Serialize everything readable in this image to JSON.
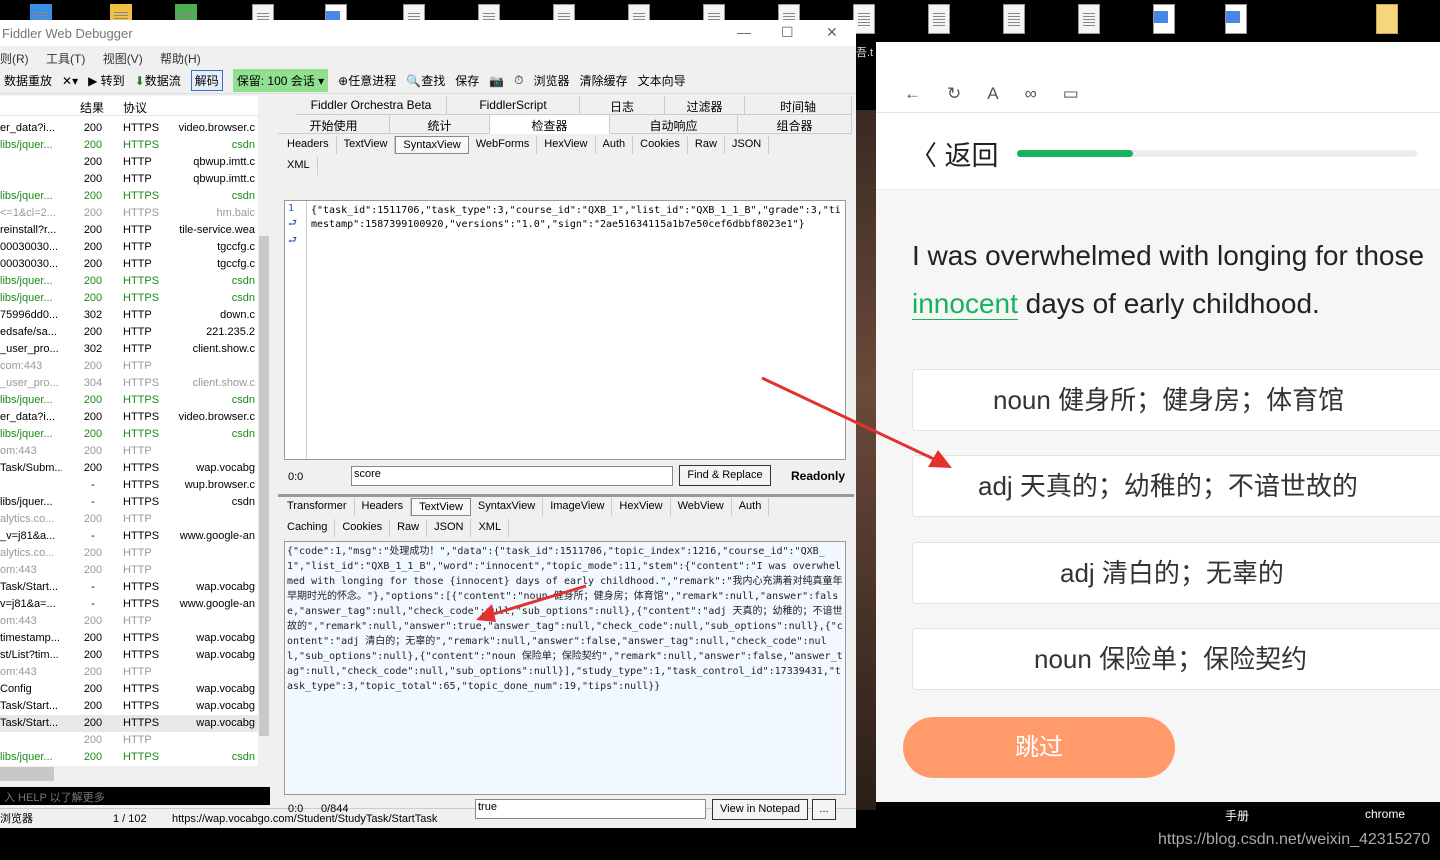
{
  "desktop": {
    "icons": [
      "app-icon",
      "app-icon",
      "app-icon",
      "text-file-icon",
      "word-file-icon",
      "text-file-icon",
      "text-file-icon",
      "text-file-icon",
      "text-file-icon",
      "text-file-icon",
      "text-file-icon",
      "text-file-icon",
      "text-file-icon",
      "text-file-icon",
      "text-file-icon",
      "word-file-icon",
      "word-file-icon",
      "folder-icon"
    ],
    "label_partial": "吾.t",
    "bottom_labels": [
      "手册",
      "chrome"
    ],
    "watermark": "https://blog.csdn.net/weixin_42315270"
  },
  "fiddler": {
    "title": "Fiddler Web Debugger",
    "menu": [
      "规则(R)",
      "工具(T)",
      "视图(V)",
      "帮助(H)"
    ],
    "toolbar": {
      "replay": "数据重放",
      "remove": "✕▾",
      "go": "▶ 转到",
      "stream": "数据流",
      "decode": "解码",
      "keep": "保留: 100 会话 ▾",
      "any_process": "任意进程",
      "find": "查找",
      "save": "保存",
      "browse": "浏览器",
      "clear_cache": "清除缓存",
      "text_wizard": "文本向导"
    },
    "columns": {
      "result": "结果",
      "protocol": "协议"
    },
    "sessions": [
      {
        "url": "er_data?i...",
        "result": "200",
        "protocol": "HTTPS",
        "host": "video.browser.c",
        "style": "normal"
      },
      {
        "url": "libs/jquer...",
        "result": "200",
        "protocol": "HTTPS",
        "host": "csdn",
        "style": "green"
      },
      {
        "url": "",
        "result": "200",
        "protocol": "HTTP",
        "host": "qbwup.imtt.c",
        "style": "normal"
      },
      {
        "url": "",
        "result": "200",
        "protocol": "HTTP",
        "host": "qbwup.imtt.c",
        "style": "normal"
      },
      {
        "url": "libs/jquer...",
        "result": "200",
        "protocol": "HTTPS",
        "host": "csdn",
        "style": "green"
      },
      {
        "url": "<=1&cl=2...",
        "result": "200",
        "protocol": "HTTPS",
        "host": "hm.baic",
        "style": "gray"
      },
      {
        "url": "reinstall?r...",
        "result": "200",
        "protocol": "HTTP",
        "host": "tile-service.wea",
        "style": "normal"
      },
      {
        "url": "00030030...",
        "result": "200",
        "protocol": "HTTP",
        "host": "tgccfg.c",
        "style": "normal"
      },
      {
        "url": "00030030...",
        "result": "200",
        "protocol": "HTTP",
        "host": "tgccfg.c",
        "style": "normal"
      },
      {
        "url": "libs/jquer...",
        "result": "200",
        "protocol": "HTTPS",
        "host": "csdn",
        "style": "green"
      },
      {
        "url": "libs/jquer...",
        "result": "200",
        "protocol": "HTTPS",
        "host": "csdn",
        "style": "green"
      },
      {
        "url": "75996dd0...",
        "result": "302",
        "protocol": "HTTP",
        "host": "down.c",
        "style": "normal"
      },
      {
        "url": "edsafe/sa...",
        "result": "200",
        "protocol": "HTTP",
        "host": "221.235.2",
        "style": "normal"
      },
      {
        "url": "_user_pro...",
        "result": "302",
        "protocol": "HTTP",
        "host": "client.show.c",
        "style": "normal"
      },
      {
        "url": "com:443",
        "result": "200",
        "protocol": "HTTP",
        "host": "",
        "style": "gray"
      },
      {
        "url": "_user_pro...",
        "result": "304",
        "protocol": "HTTPS",
        "host": "client.show.c",
        "style": "gray"
      },
      {
        "url": "libs/jquer...",
        "result": "200",
        "protocol": "HTTPS",
        "host": "csdn",
        "style": "green"
      },
      {
        "url": "er_data?i...",
        "result": "200",
        "protocol": "HTTPS",
        "host": "video.browser.c",
        "style": "normal"
      },
      {
        "url": "libs/jquer...",
        "result": "200",
        "protocol": "HTTPS",
        "host": "csdn",
        "style": "green"
      },
      {
        "url": "om:443",
        "result": "200",
        "protocol": "HTTP",
        "host": "",
        "style": "gray"
      },
      {
        "url": "Task/Subm...",
        "result": "200",
        "protocol": "HTTPS",
        "host": "wap.vocabg",
        "style": "normal"
      },
      {
        "url": "",
        "result": "-",
        "protocol": "HTTPS",
        "host": "wup.browser.c",
        "style": "normal"
      },
      {
        "url": "libs/jquer...",
        "result": "-",
        "protocol": "HTTPS",
        "host": "csdn",
        "style": "normal"
      },
      {
        "url": "alytics.co...",
        "result": "200",
        "protocol": "HTTP",
        "host": "",
        "style": "gray"
      },
      {
        "url": "_v=j81&a...",
        "result": "-",
        "protocol": "HTTPS",
        "host": "www.google-an",
        "style": "normal"
      },
      {
        "url": "alytics.co...",
        "result": "200",
        "protocol": "HTTP",
        "host": "",
        "style": "gray"
      },
      {
        "url": "om:443",
        "result": "200",
        "protocol": "HTTP",
        "host": "",
        "style": "gray"
      },
      {
        "url": "Task/Start...",
        "result": "-",
        "protocol": "HTTPS",
        "host": "wap.vocabg",
        "style": "normal"
      },
      {
        "url": "v=j81&a=...",
        "result": "-",
        "protocol": "HTTPS",
        "host": "www.google-an",
        "style": "normal"
      },
      {
        "url": "om:443",
        "result": "200",
        "protocol": "HTTP",
        "host": "",
        "style": "gray"
      },
      {
        "url": "timestamp...",
        "result": "200",
        "protocol": "HTTPS",
        "host": "wap.vocabg",
        "style": "normal"
      },
      {
        "url": "st/List?tim...",
        "result": "200",
        "protocol": "HTTPS",
        "host": "wap.vocabg",
        "style": "normal"
      },
      {
        "url": "om:443",
        "result": "200",
        "protocol": "HTTP",
        "host": "",
        "style": "gray"
      },
      {
        "url": "Config",
        "result": "200",
        "protocol": "HTTPS",
        "host": "wap.vocabg",
        "style": "normal"
      },
      {
        "url": "Task/Start...",
        "result": "200",
        "protocol": "HTTPS",
        "host": "wap.vocabg",
        "style": "normal"
      },
      {
        "url": "Task/Start...",
        "result": "200",
        "protocol": "HTTPS",
        "host": "wap.vocabg",
        "style": "selected"
      },
      {
        "url": "",
        "result": "200",
        "protocol": "HTTP",
        "host": "",
        "style": "gray"
      },
      {
        "url": "libs/jquer...",
        "result": "200",
        "protocol": "HTTPS",
        "host": "csdn",
        "style": "green"
      }
    ],
    "quickexec": "入 HELP 以了解更多",
    "status": {
      "mode": "浏览器",
      "count": "1 / 102",
      "url": "https://wap.vocabgo.com/Student/StudyTask/StartTask"
    },
    "tabs_row1": [
      "Fiddler Orchestra Beta",
      "FiddlerScript",
      "日志",
      "过滤器",
      "时间轴"
    ],
    "tabs_row2": [
      "开始使用",
      "统计",
      "检查器",
      "自动响应",
      "组合器"
    ],
    "request_tabs": [
      "Headers",
      "TextView",
      "SyntaxView",
      "WebForms",
      "HexView",
      "Auth",
      "Cookies",
      "Raw",
      "JSON"
    ],
    "request_tabs2": [
      "XML"
    ],
    "request_body": "{\"task_id\":1511706,\"task_type\":3,\"course_id\":\"QXB_1\",\"list_id\":\"QXB_1_1_B\",\"grade\":3,\"timestamp\":1587399100920,\"versions\":\"1.0\",\"sign\":\"2ae51634115a1b7e50cef6dbbf8023e1\"}",
    "line_number": "1",
    "find": {
      "pos": "0:0",
      "value": "score",
      "button": "Find & Replace",
      "readonly": "Readonly"
    },
    "response_tabs": [
      "Transformer",
      "Headers",
      "TextView",
      "SyntaxView",
      "ImageView",
      "HexView",
      "WebView",
      "Auth"
    ],
    "response_tabs2": [
      "Caching",
      "Cookies",
      "Raw",
      "JSON",
      "XML"
    ],
    "response_body": "{\"code\":1,\"msg\":\"处理成功！\",\"data\":{\"task_id\":1511706,\"topic_index\":1216,\"course_id\":\"QXB_1\",\"list_id\":\"QXB_1_1_B\",\"word\":\"innocent\",\"topic_mode\":11,\"stem\":{\"content\":\"I was overwhelmed with longing for those {innocent} days of early childhood.\",\"remark\":\"我内心充满着对纯真童年早期时光的怀念。\"},\"options\":[{\"content\":\"noun 健身所；健身房；体育馆\",\"remark\":null,\"answer\":false,\"answer_tag\":null,\"check_code\":null,\"sub_options\":null},{\"content\":\"adj 天真的；幼稚的；不谙世故的\",\"remark\":null,\"answer\":true,\"answer_tag\":null,\"check_code\":null,\"sub_options\":null},{\"content\":\"adj 清白的；无辜的\",\"remark\":null,\"answer\":false,\"answer_tag\":null,\"check_code\":null,\"sub_options\":null},{\"content\":\"noun 保险单；保险契约\",\"remark\":null,\"answer\":false,\"answer_tag\":null,\"check_code\":null,\"sub_options\":null}],\"study_type\":1,\"task_control_id\":17339431,\"task_type\":3,\"topic_total\":65,\"topic_done_num\":19,\"tips\":null}}",
    "bottom": {
      "pos": "0:0",
      "count": "0/844",
      "find_value": "true",
      "notepad": "View in Notepad",
      "more": "..."
    }
  },
  "browser": {
    "toolbar_icons": [
      "back-icon",
      "refresh-icon",
      "font-icon",
      "link-icon",
      "window-icon"
    ],
    "back": "〈 返回",
    "progress": 0.29,
    "progress_color": "#16b35a",
    "sentence_before": "I was overwhelmed with longing for those",
    "highlight": "innocent",
    "sentence_after": " days of early childhood.",
    "options": [
      "noun 健身所；健身房；体育馆",
      "adj 天真的；幼稚的；不谙世故的",
      "adj 清白的；无辜的",
      "noun 保险单；保险契约"
    ],
    "skip": "跳过",
    "skip_color": "#ff9a6b"
  }
}
